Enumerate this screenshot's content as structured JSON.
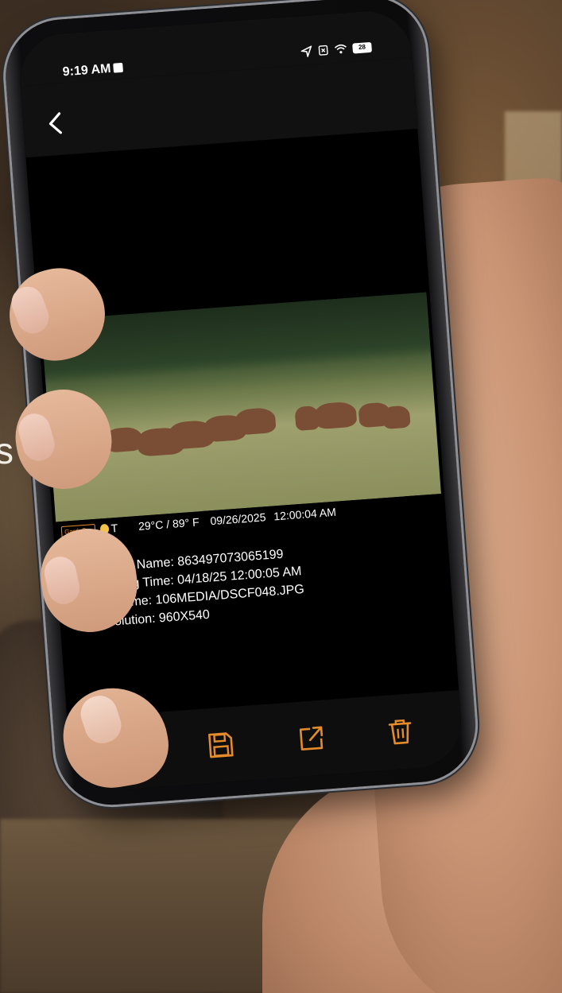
{
  "background": {
    "partial_letter": "s"
  },
  "status_bar": {
    "time": "9:19 AM",
    "battery_level": "28",
    "icons": [
      "location-arrow-icon",
      "no-sim-icon",
      "wifi-icon",
      "battery-icon"
    ]
  },
  "nav": {
    "back_icon": "chevron-left-icon"
  },
  "photo": {
    "brand_badge": "GardePro",
    "moon_phase_label": "T",
    "temperature": "29°C / 89° F",
    "date": "09/26/2025",
    "time": "12:00:04 AM"
  },
  "info": {
    "camera_name_label": "Camera Name:",
    "camera_name_value": "863497073065199",
    "shooting_time_label": "Shooting Time:",
    "shooting_time_value": "04/18/25 12:00:05 AM",
    "file_name_label": "File Name:",
    "file_name_value": "106MEDIA/DSCF048.JPG",
    "resolution_label": "Resolution:",
    "resolution_value": "960X540"
  },
  "toolbar": {
    "hd_label": "HD",
    "icons": [
      "hd-icon",
      "save-icon",
      "share-icon",
      "delete-icon"
    ]
  },
  "colors": {
    "accent": "#e58b2a",
    "screen_bg": "#000000",
    "text": "#ffffff"
  }
}
